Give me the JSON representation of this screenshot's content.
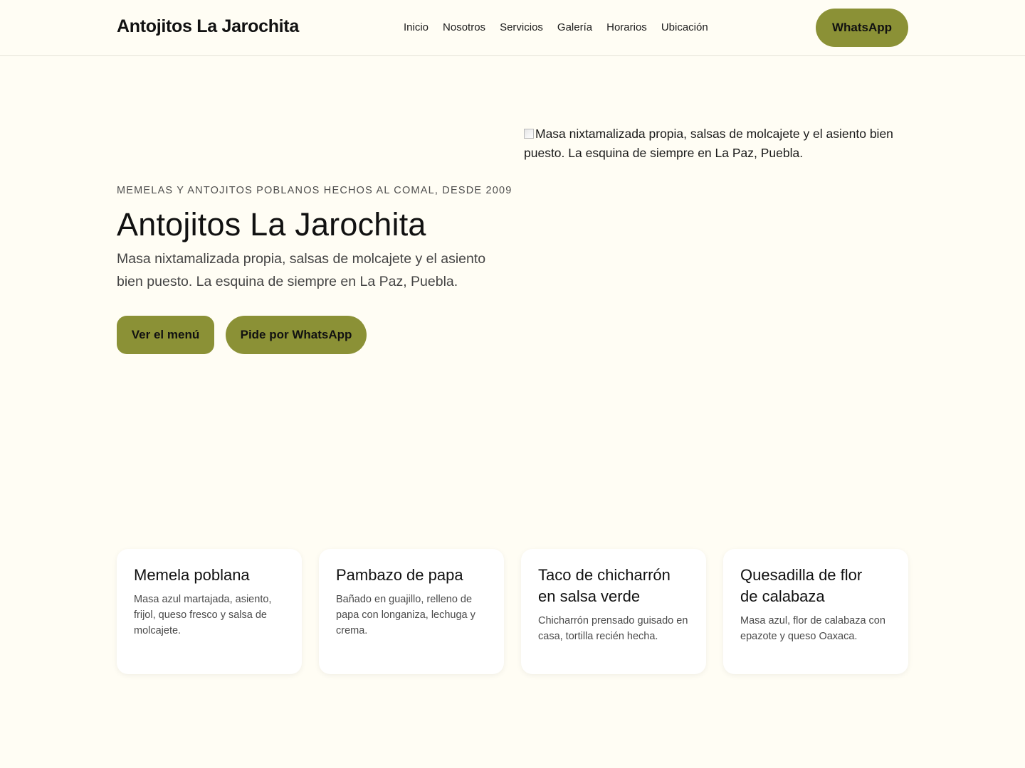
{
  "header": {
    "brand": "Antojitos La Jarochita",
    "nav": [
      "Inicio",
      "Nosotros",
      "Servicios",
      "Galería",
      "Horarios",
      "Ubicación"
    ],
    "cta_label": "WhatsApp"
  },
  "hero": {
    "eyebrow": "MEMELAS Y ANTOJITOS POBLANOS HECHOS AL COMAL, DESDE 2009",
    "title": "Antojitos La Jarochita",
    "subtitle": "Masa nixtamalizada propia, salsas de molcajete y el asiento bien puesto. La esquina de siempre en La Paz, Puebla.",
    "primary_button": "Ver el menú",
    "secondary_button": "Pide por WhatsApp",
    "image_alt": "Masa nixtamalizada propia, salsas de molcajete y el asiento bien puesto. La esquina de siempre en La Paz, Puebla."
  },
  "cards": [
    {
      "title": "Memela poblana",
      "desc": "Masa azul martajada, asiento, frijol, queso fresco y salsa de molcajete."
    },
    {
      "title": "Pambazo de papa",
      "desc": "Bañado en guajillo, relleno de papa con longaniza, lechuga y crema."
    },
    {
      "title": "Taco de chicharrón en salsa verde",
      "desc": "Chicharrón prensado guisado en casa, tortilla recién hecha."
    },
    {
      "title": "Quesadilla de flor de calabaza",
      "desc": "Masa azul, flor de calabaza con epazote y queso Oaxaca."
    }
  ],
  "colors": {
    "background": "#fffdf4",
    "accent": "#8b9136",
    "text": "#111111"
  }
}
